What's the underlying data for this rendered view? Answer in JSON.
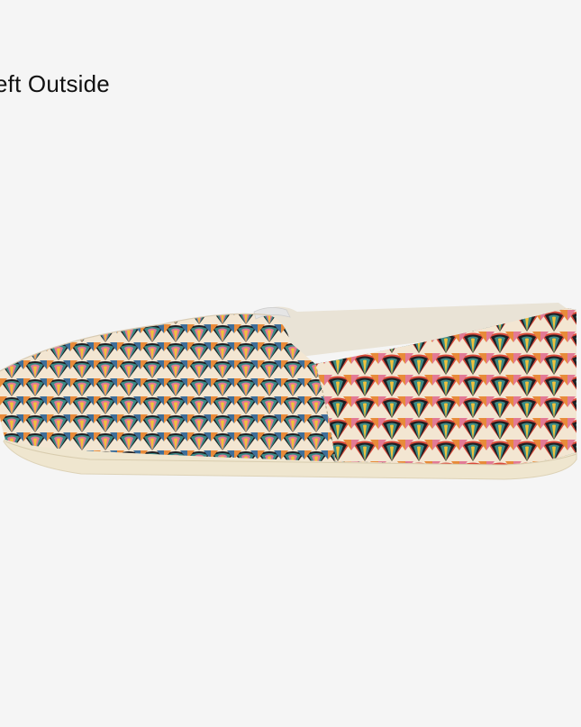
{
  "image": {
    "view_label": "eft Outside",
    "subject": "slip-on-shoe",
    "colors": {
      "background": "#f5f5f5",
      "sole": "#efe6cf",
      "pattern_cream": "#f3e6d2",
      "pattern_black": "#1e1e22",
      "pattern_teal": "#3b8a86",
      "pattern_blue": "#3f6f9a",
      "pattern_pink": "#e27a95",
      "pattern_orange": "#e88b3a",
      "pattern_yellow": "#f0c23b",
      "pattern_red": "#d94a3a"
    }
  }
}
